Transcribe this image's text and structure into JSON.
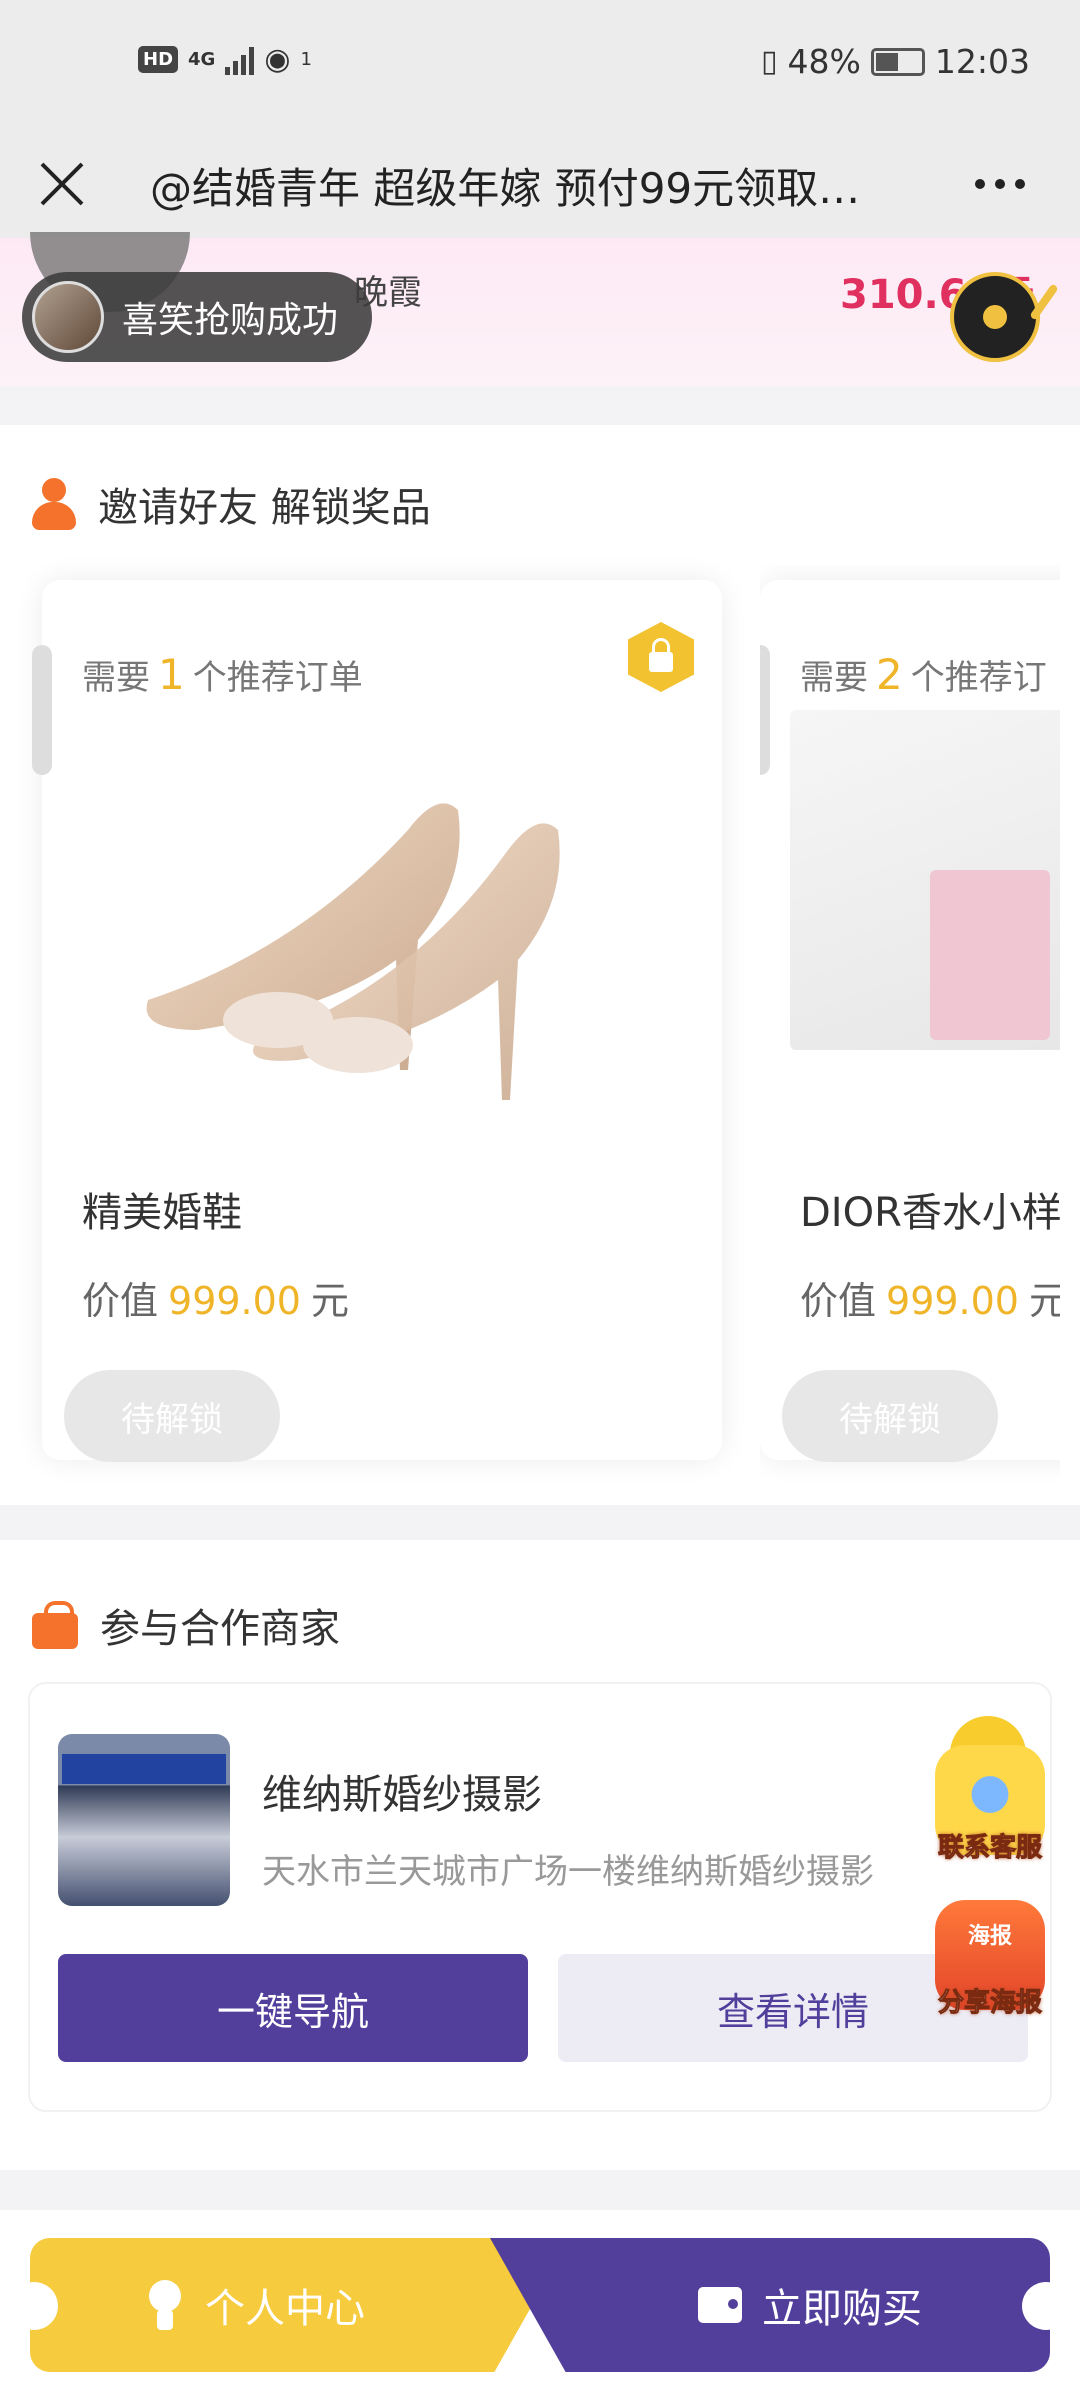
{
  "status_bar": {
    "hd": "HD",
    "network": "4G",
    "hotspot_count": "1",
    "battery": "48%",
    "time": "12:03"
  },
  "nav": {
    "title": "@结婚青年 超级年嫁 预付99元领取…"
  },
  "banner": {
    "name": "晚霞",
    "price": "310.60元",
    "toast": "喜笑抢购成功"
  },
  "invite": {
    "title": "邀请好友 解锁奖品",
    "cards": [
      {
        "req_prefix": "需要",
        "req_num": "1",
        "req_suffix": "个推荐订单",
        "name": "精美婚鞋",
        "val_prefix": "价值",
        "value": "999.00",
        "val_suffix": "元",
        "button": "待解锁"
      },
      {
        "req_prefix": "需要",
        "req_num": "2",
        "req_suffix": "个推荐订",
        "name": "DIOR香水小样",
        "val_prefix": "价值",
        "value": "999.00",
        "val_suffix": "元",
        "button": "待解锁"
      }
    ]
  },
  "merchants": {
    "title": "参与合作商家",
    "store": {
      "name": "维纳斯婚纱摄影",
      "address": "天水市兰天城市广场一楼维纳斯婚纱摄影",
      "nav_button": "一键导航",
      "detail_button": "查看详情"
    }
  },
  "float": {
    "service": "联系客服",
    "poster_tag": "海报",
    "poster": "分享海报"
  },
  "bottom": {
    "profile": "个人中心",
    "buy": "立即购买"
  },
  "colors": {
    "accent_purple": "#523f9c",
    "accent_yellow": "#f7cb3e",
    "price_red": "#e03060",
    "value_gold": "#f0b428"
  }
}
